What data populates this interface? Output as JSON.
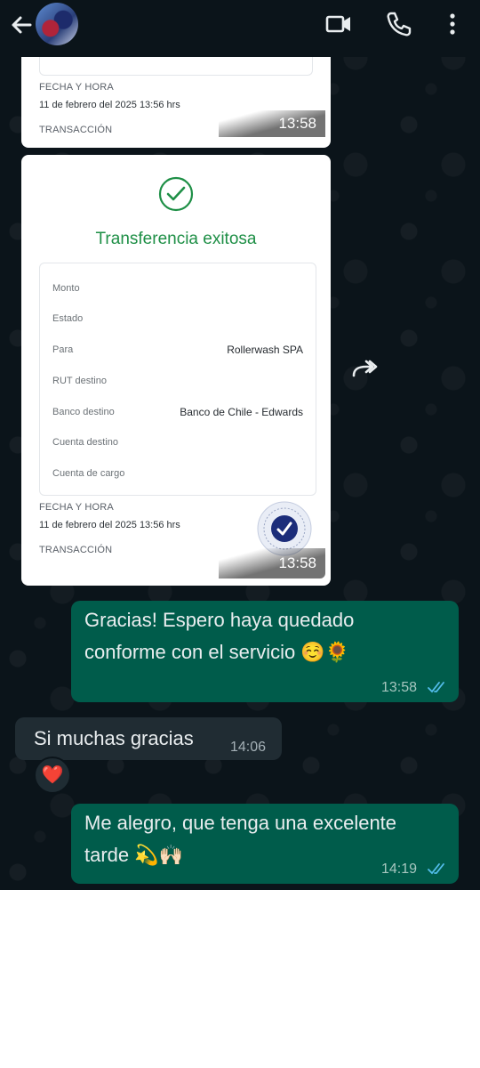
{
  "header": {
    "back_icon": "arrow-left-icon",
    "video_icon": "video-camera-icon",
    "call_icon": "phone-icon",
    "menu_icon": "more-vertical-icon"
  },
  "receipt_top": {
    "fecha_label": "FECHA Y HORA",
    "fecha_value": "11 de febrero del 2025 13:56 hrs",
    "transaccion_label": "TRANSACCIÓN",
    "time": "13:58"
  },
  "receipt_main": {
    "title": "Transferencia exitosa",
    "rows": [
      {
        "label": "Monto",
        "value": ""
      },
      {
        "label": "Estado",
        "value": ""
      },
      {
        "label": "Para",
        "value": "Rollerwash SPA"
      },
      {
        "label": "RUT destino",
        "value": ""
      },
      {
        "label": "Banco destino",
        "value": "Banco de Chile - Edwards"
      },
      {
        "label": "Cuenta destino",
        "value": ""
      },
      {
        "label": "Cuenta de cargo",
        "value": ""
      }
    ],
    "fecha_label": "FECHA Y HORA",
    "fecha_value": "11 de febrero del 2025 13:56 hrs",
    "transaccion_label": "TRANSACCIÓN",
    "time": "13:58",
    "forward_icon": "forward-icon"
  },
  "messages": [
    {
      "id": "m1",
      "direction": "out",
      "text_line1": "Gracias! Espero haya quedado",
      "text_line2": "conforme con el servicio ☺️🌻",
      "time": "13:58",
      "status": "read"
    },
    {
      "id": "m2",
      "direction": "in",
      "text": "Si muchas gracias",
      "time": "14:06",
      "reaction": "❤️"
    },
    {
      "id": "m3",
      "direction": "out",
      "text_line1": "Me alegro, que tenga una excelente",
      "text_line2": "tarde 💫🙌🏻",
      "time": "14:19",
      "status": "read"
    }
  ],
  "colors": {
    "background": "#0b141a",
    "outgoing_bubble": "#005c4b",
    "incoming_bubble": "#202c33",
    "read_check": "#53bdeb",
    "success_green": "#1e8f46"
  }
}
